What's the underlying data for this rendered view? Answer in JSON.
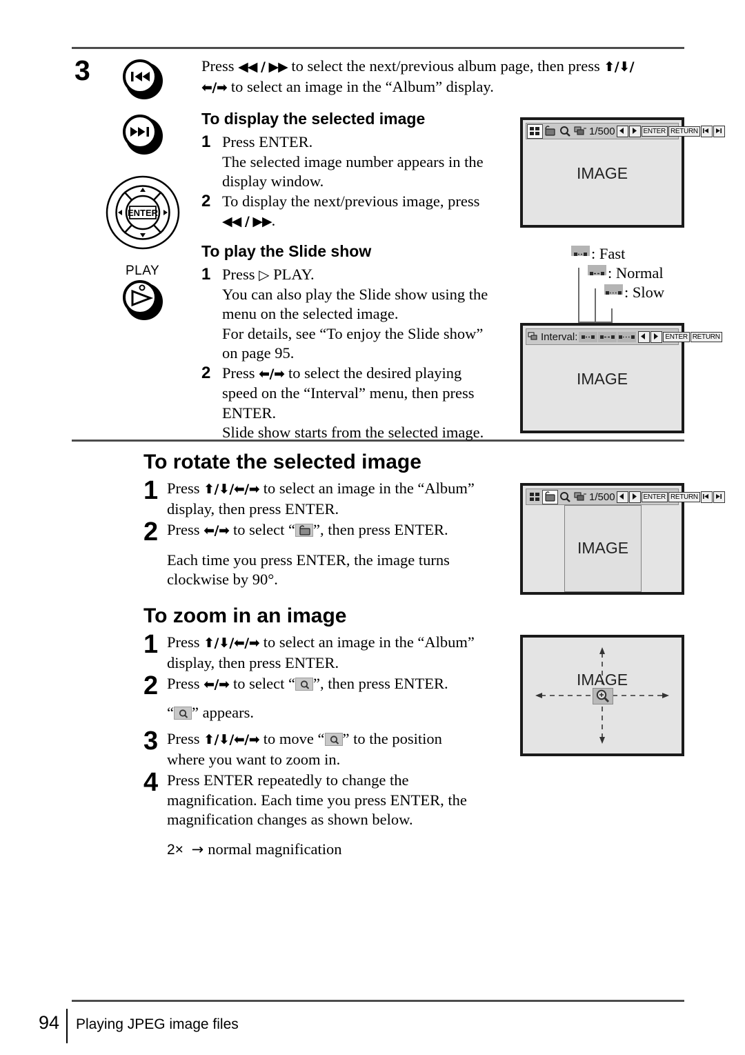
{
  "page": {
    "number": "94",
    "footer_title": "Playing JPEG image files"
  },
  "step3": {
    "number": "3",
    "line1_pre": "Press ",
    "line1_track": "◀◀ / ▶▶",
    "line1_mid": " to select the next/previous album page, then press ",
    "line1_arrows": "⬆/⬇/",
    "line2_arrows": "⬅/➡",
    "line2_post": " to select an image in the “Album” display."
  },
  "remote_buttons": [
    {
      "name": "prev-track-button",
      "label": ""
    },
    {
      "name": "next-track-button",
      "label": ""
    },
    {
      "name": "dpad-enter-button",
      "label": "ENTER"
    },
    {
      "name": "play-button",
      "label": "PLAY"
    }
  ],
  "section_display": {
    "heading": "To display the selected image",
    "steps": [
      {
        "num": "1",
        "lines": [
          "Press ENTER.",
          "The selected image number appears in the",
          "display window."
        ]
      },
      {
        "num": "2",
        "lines": [
          "To display the next/previous image, press"
        ],
        "trailing_track": "◀◀ / ▶▶",
        "trailing_period": "."
      }
    ]
  },
  "section_slideshow": {
    "heading": "To play the Slide show",
    "step1": {
      "num": "1",
      "line1_pre": "Press ",
      "line1_play": "▷",
      "line1_post": " PLAY.",
      "lines": [
        "You can also play the Slide show using the",
        "menu on the selected image.",
        "For details, see “To enjoy the Slide show”",
        "on page 95."
      ]
    },
    "step2": {
      "num": "2",
      "line1_pre": "Press ",
      "line1_arrows": "⬅/➡",
      "line1_post": " to select the desired playing",
      "lines": [
        "speed on the “Interval” menu, then press",
        "ENTER.",
        "Slide show starts from the selected image."
      ]
    }
  },
  "section_rotate": {
    "heading": "To rotate the selected image",
    "step1": {
      "num": "1",
      "pre": "Press ",
      "arrows": "⬆/⬇/⬅/➡",
      "post": " to select an image in the “Album”",
      "line2": "display, then press ENTER."
    },
    "step2": {
      "num": "2",
      "pre": "Press ",
      "arrows": "⬅/➡",
      "mid": " to select “",
      "post": "”, then press ENTER.",
      "note1": "Each time you press ENTER, the image turns",
      "note2": "clockwise by 90°."
    }
  },
  "section_zoom": {
    "heading": "To zoom in an image",
    "step1": {
      "num": "1",
      "pre": "Press ",
      "arrows": "⬆/⬇/⬅/➡",
      "post": " to select an image in the “Album”",
      "line2": "display, then press ENTER."
    },
    "step2": {
      "num": "2",
      "pre": "Press ",
      "arrows": "⬅/➡",
      "mid": " to select “",
      "post": "”, then press ENTER.",
      "appears_pre": "“",
      "appears_post": "” appears."
    },
    "step3": {
      "num": "3",
      "pre": "Press ",
      "arrows": "⬆/⬇/⬅/➡",
      "mid": " to move “",
      "post": "” to the position",
      "line2": "where you want to zoom in."
    },
    "step4": {
      "num": "4",
      "line1": "Press ENTER repeatedly to change the",
      "line2": "magnification.  Each time you press ENTER, the",
      "line3": "magnification changes as shown below.",
      "mag_from": "2×",
      "mag_arrow": "→",
      "mag_to": "normal magnification"
    }
  },
  "screens": {
    "image_label": "IMAGE",
    "osd_default": {
      "shutter": "1/500",
      "enter_key": "ENTER",
      "return_key": "RETURN",
      "icons": [
        "album-grid-icon",
        "rotate-icon",
        "zoom-icon",
        "slideshow-icon"
      ]
    },
    "osd_interval": {
      "label": "Interval:",
      "enter_key": "ENTER",
      "return_key": "RETURN",
      "speeds": [
        "fast",
        "normal",
        "slow"
      ]
    }
  },
  "callouts": [
    {
      "name": "fast-callout",
      "text": ": Fast"
    },
    {
      "name": "normal-callout",
      "text": ": Normal"
    },
    {
      "name": "slow-callout",
      "text": ": Slow"
    }
  ],
  "colors": {
    "rule": "#4c4c4c",
    "screen_bg": "#e4e4e4",
    "screen_border": "#1a1a1a",
    "osd_bg": "#c9c9c9",
    "chip_bg": "#b4b4b4"
  }
}
